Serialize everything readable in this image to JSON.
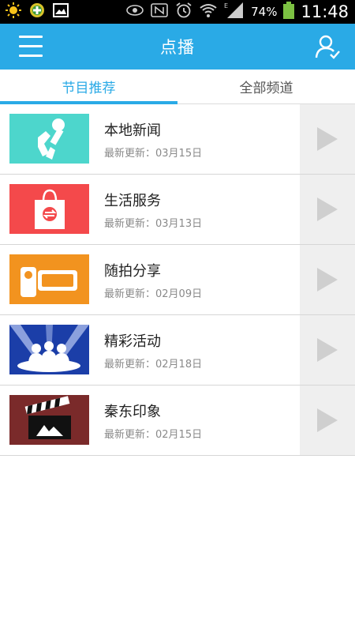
{
  "status_bar": {
    "battery_percent": "74%",
    "time": "11:48"
  },
  "header": {
    "title": "点播"
  },
  "tabs": [
    {
      "label": "节目推荐",
      "active": true
    },
    {
      "label": "全部频道",
      "active": false
    }
  ],
  "programs": [
    {
      "title": "本地新闻",
      "updated": "最新更新：03月15日",
      "thumb_color": "#4dd6cc",
      "icon": "microphone-icon"
    },
    {
      "title": "生活服务",
      "updated": "最新更新：03月13日",
      "thumb_color": "#f4494b",
      "icon": "shopping-bag-icon"
    },
    {
      "title": "随拍分享",
      "updated": "最新更新：02月09日",
      "thumb_color": "#f2931f",
      "icon": "camcorder-icon"
    },
    {
      "title": "精彩活动",
      "updated": "最新更新：02月18日",
      "thumb_color": "#1b3ea8",
      "icon": "stage-audience-icon"
    },
    {
      "title": "秦东印象",
      "updated": "最新更新：02月15日",
      "thumb_color": "#7a2a2a",
      "icon": "clapperboard-icon"
    }
  ],
  "colors": {
    "accent": "#2aaae6"
  }
}
